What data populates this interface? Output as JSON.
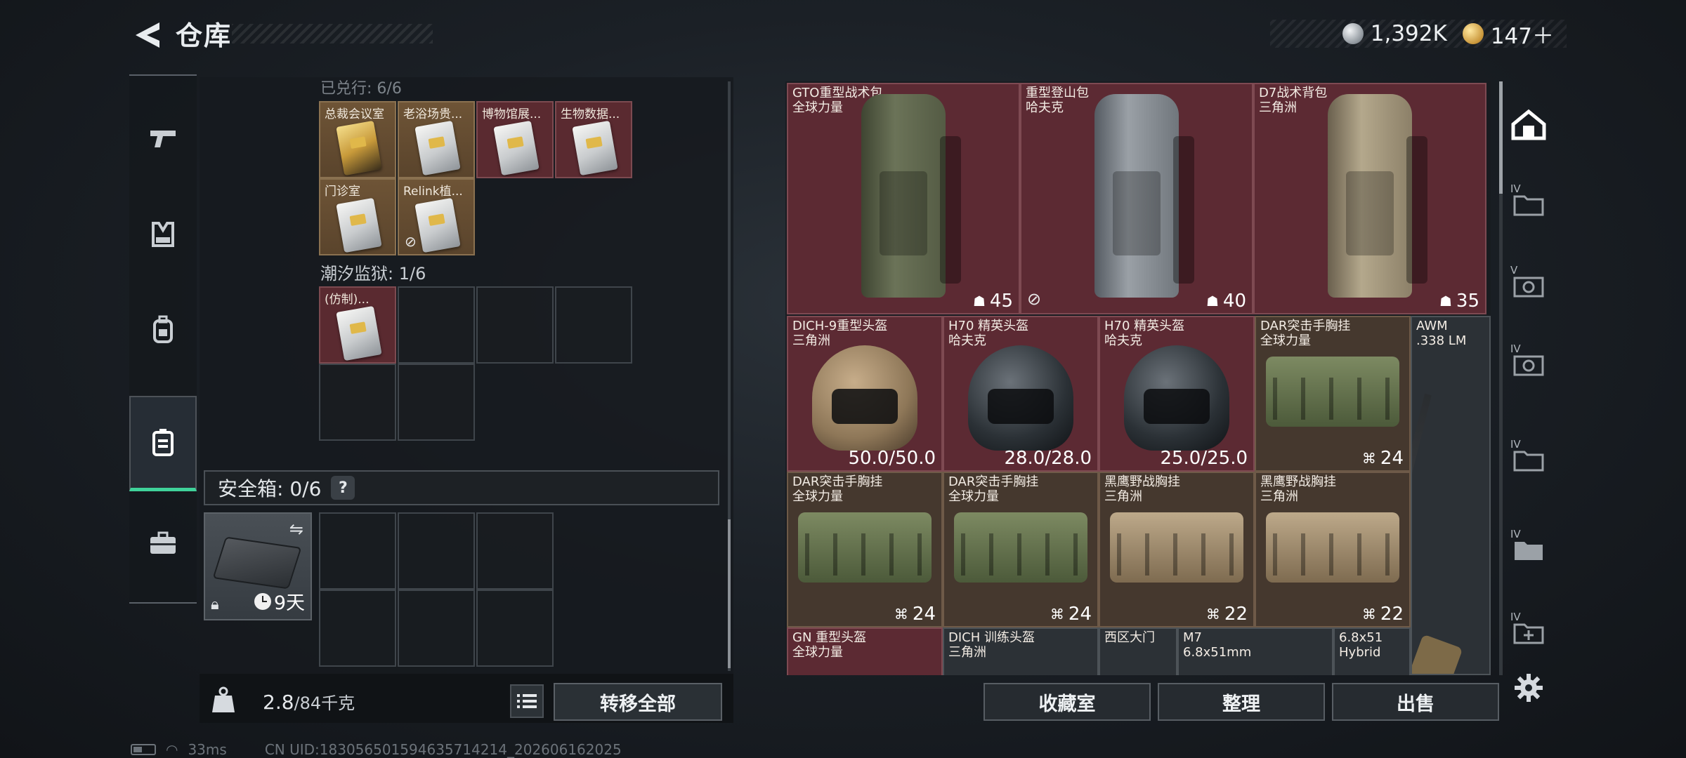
{
  "header": {
    "title": "仓库"
  },
  "currency": {
    "silver": "1,392K",
    "gold": "147＋"
  },
  "left_nav": [
    "gun-icon",
    "vest-icon",
    "backpack-icon",
    "storage-icon",
    "toolbox-icon"
  ],
  "storage": {
    "section_cut": "已兑行: 6/6",
    "section1_items": [
      "总裁会议室",
      "老浴场贵...",
      "博物馆展...",
      "生物数据...",
      "门诊室",
      "Relink植..."
    ],
    "section2_label": "潮汐监狱: 1/6",
    "section2_items": [
      "(仿制)..."
    ],
    "safe_label": "安全箱: 0/6",
    "safe_help": "?",
    "safe_time": "9天",
    "weight_current": "2.8",
    "weight_max": "/84千克",
    "transfer_all": "转移全部"
  },
  "items": [
    {
      "name": "GTO重型战术包",
      "sub": "全球力量",
      "value": "45"
    },
    {
      "name": "重型登山包",
      "sub": "哈夫克",
      "value": "40"
    },
    {
      "name": "D7战术背包",
      "sub": "三角洲",
      "value": "35"
    },
    {
      "name": "DICH-9重型头盔",
      "sub": "三角洲",
      "value": "50.0/50.0"
    },
    {
      "name": "H70 精英头盔",
      "sub": "哈夫克",
      "value": "28.0/28.0"
    },
    {
      "name": "H70 精英头盔",
      "sub": "哈夫克",
      "value": "25.0/25.0"
    },
    {
      "name": "DAR突击手胸挂",
      "sub": "全球力量",
      "value": "24"
    },
    {
      "name": "AWM",
      "sub": ".338 LM",
      "value": ""
    },
    {
      "name": "DAR突击手胸挂",
      "sub": "全球力量",
      "value": "24"
    },
    {
      "name": "DAR突击手胸挂",
      "sub": "全球力量",
      "value": "24"
    },
    {
      "name": "黑鹰野战胸挂",
      "sub": "三角洲",
      "value": "22"
    },
    {
      "name": "黑鹰野战胸挂",
      "sub": "三角洲",
      "value": "22"
    },
    {
      "name": "GN 重型头盔",
      "sub": "全球力量",
      "value": ""
    },
    {
      "name": "DICH 训练头盔",
      "sub": "三角洲",
      "value": ""
    },
    {
      "name": "西区大门",
      "sub": "",
      "value": ""
    },
    {
      "name": "M7",
      "sub": "6.8x51mm",
      "value": ""
    },
    {
      "name": "6.8x51",
      "sub": "Hybrid",
      "value": ""
    }
  ],
  "right_sidebar": [
    "IV",
    "V",
    "IV",
    "IV",
    "IV",
    "IV"
  ],
  "actions": {
    "collection": "收藏室",
    "sort": "整理",
    "sell": "出售"
  },
  "status": {
    "ping": "33ms",
    "uid": "CN UID:18305650159463571421​4_202606162025"
  },
  "colors": {
    "accent": "#3fd29a",
    "rare_red": "#5c2a33",
    "epic_brown": "#45382e"
  }
}
